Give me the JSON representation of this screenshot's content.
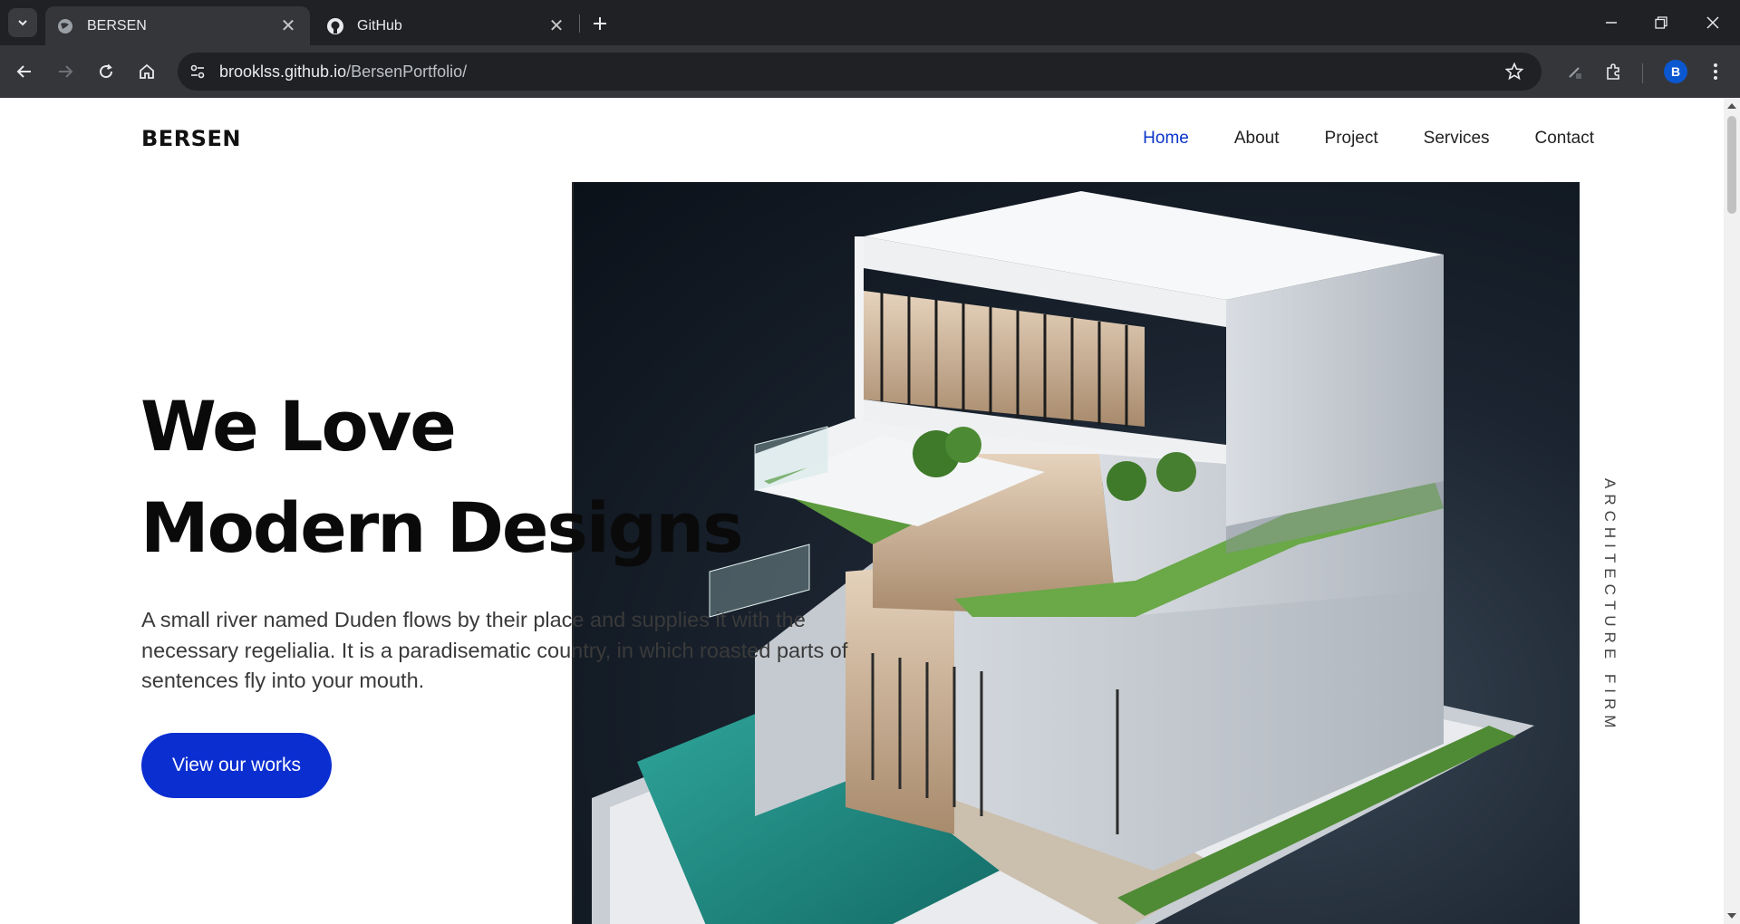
{
  "browser": {
    "tabs": [
      {
        "title": "BERSEN",
        "favicon": "globe-icon",
        "active": true
      },
      {
        "title": "GitHub",
        "favicon": "github-icon",
        "active": false
      }
    ],
    "url_host": "brooklss.github.io",
    "url_path": "/BersenPortfolio/",
    "profile_initial": "B",
    "accent": "#0b57d0"
  },
  "site": {
    "logo": "BERSEN",
    "nav": [
      {
        "label": "Home",
        "active": true
      },
      {
        "label": "About",
        "active": false
      },
      {
        "label": "Project",
        "active": false
      },
      {
        "label": "Services",
        "active": false
      },
      {
        "label": "Contact",
        "active": false
      }
    ],
    "hero": {
      "headline_line1": "We Love",
      "headline_line2": "Modern Designs",
      "description": "A small river named Duden flows by their place and supplies it with the necessary regelialia. It is a paradisematic country, in which roasted parts of sentences fly into your mouth.",
      "cta_label": "View our works",
      "side_label": "ARCHITECTURE FIRM"
    },
    "colors": {
      "primary": "#0b2ed1",
      "nav_active": "#0b35c9"
    }
  }
}
